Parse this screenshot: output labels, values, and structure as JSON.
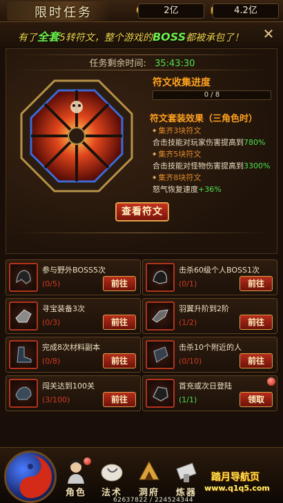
{
  "header": {
    "title": "限时任务",
    "resource1": "2亿",
    "resource2": "4.2亿"
  },
  "banner": {
    "pre": "有了",
    "highlight1": "全套",
    "mid": "5转符文，整个游戏的",
    "highlight2": "BOSS",
    "post": "都被承包了！"
  },
  "timer": {
    "label": "任务剩余时间:",
    "value": "35:43:30"
  },
  "rune": {
    "progress_title": "符文收集进度",
    "progress_text": "0 / 8",
    "progress_fraction": 0,
    "set_title": "符文套装效果（三角色时）",
    "bonuses": [
      {
        "cond": "集齐3块符文",
        "desc": "合击技能对玩家伤害提高到",
        "value": "780%"
      },
      {
        "cond": "集齐5块符文",
        "desc": "合击技能对怪物伤害提高到",
        "value": "3300%"
      },
      {
        "cond": "集齐8块符文",
        "desc": "怒气恢复速度",
        "value": "+36%"
      }
    ],
    "view_button": "查看符文"
  },
  "tasks": [
    {
      "name": "参与野外BOSS5次",
      "progress": "(0/5)",
      "button": "前往"
    },
    {
      "name": "击杀60级个人BOSS1次",
      "progress": "(0/1)",
      "button": "前往"
    },
    {
      "name": "寻宝装备3次",
      "progress": "(0/3)",
      "button": "前往"
    },
    {
      "name": "羽翼升阶到2阶",
      "progress": "(1/2)",
      "button": "前往"
    },
    {
      "name": "完成8次材料副本",
      "progress": "(0/8)",
      "button": "前往"
    },
    {
      "name": "击杀10个附近的人",
      "progress": "(0/10)",
      "button": "前往"
    },
    {
      "name": "闯关达到100关",
      "progress": "(3/100)",
      "button": "前往"
    },
    {
      "name": "首充或次日登陆",
      "progress": "(1/1)",
      "button": "领取"
    }
  ],
  "nav": {
    "items": [
      {
        "label": "角色"
      },
      {
        "label": "法术"
      },
      {
        "label": "洞府"
      },
      {
        "label": "炼器"
      }
    ],
    "coords": "62637822 / 224524344",
    "watermark_cn": "踏月导航页",
    "watermark_url": "www.q1q5.com"
  },
  "colors": {
    "accent_orange": "#ffa21e",
    "success_green": "#4fe04f",
    "danger_red": "#d23a24",
    "banner_yellow": "#f1d54a"
  }
}
